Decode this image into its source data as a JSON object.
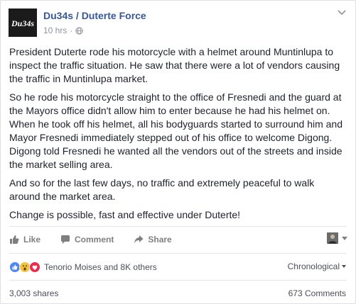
{
  "post": {
    "page_name": "Du34s / Duterte Force",
    "avatar_text": "Du34s",
    "time": "10 hrs",
    "separator": "·",
    "paragraphs": [
      "President Duterte rode his motorcycle with a helmet around Muntinlupa to inspect the traffic situation. He saw that there were a lot of vendors causing the traffic in Muntinlupa market.",
      "So he rode his motorcycle straight to the office of Fresnedi and the guard at the Mayors office didn't allow him to enter because he had his helmet on. When he took off his helmet, all his bodyguards started to surround him and Mayor Fresnedi immediately stepped out of his office to welcome Digong. Digong told Fresnedi he wanted all the vendors out of the streets and inside the market selling area.",
      "And so for the last few days, no traffic and extremely peaceful to walk around the market area.",
      "Change is possible, fast and effective under Duterte!"
    ]
  },
  "actions": {
    "like_label": "Like",
    "comment_label": "Comment",
    "share_label": "Share"
  },
  "reactions": {
    "icons": [
      "like-icon",
      "wow-icon",
      "love-icon"
    ],
    "summary": "Tenorio Moises and 8K others",
    "sort_label": "Chronological"
  },
  "footer": {
    "shares": "3,003 shares",
    "comments": "673 Comments"
  },
  "colors": {
    "link": "#365899",
    "muted": "#90949c",
    "action": "#7f7f7f",
    "like": "#4e87ef",
    "wow": "#f5c33b",
    "love": "#f0284a"
  }
}
